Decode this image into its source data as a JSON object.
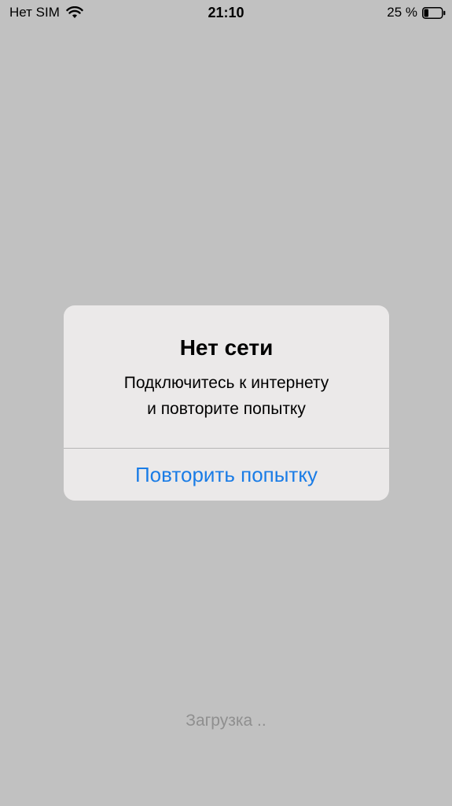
{
  "status_bar": {
    "carrier": "Нет SIM",
    "time": "21:10",
    "battery_percent": "25 %",
    "battery_level": 0.25
  },
  "alert": {
    "title": "Нет сети",
    "message_line1": "Подключитесь к интернету",
    "message_line2": "и повторите попытку",
    "button_label": "Повторить попытку"
  },
  "loading": {
    "text": "Загрузка  .."
  },
  "colors": {
    "background": "#c1c1c1",
    "alert_background": "#ecebeb",
    "button_text": "#1a7ce6",
    "loading_text": "#8f8f8f"
  },
  "icons": [
    "wifi-icon",
    "battery-icon"
  ]
}
